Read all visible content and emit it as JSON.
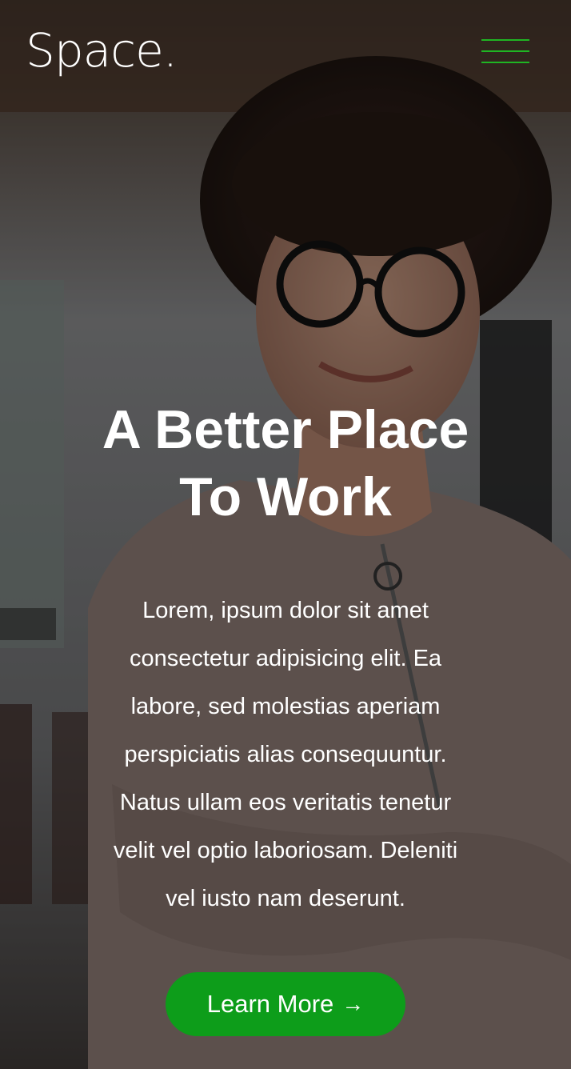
{
  "header": {
    "logo": "Space.",
    "menu_icon": "hamburger-menu-icon"
  },
  "hero": {
    "headline": "A Better Place To Work",
    "body": "Lorem, ipsum dolor sit amet consectetur adipisicing elit. Ea labore, sed molestias aperiam perspiciatis alias consequuntur. Natus ullam eos veritatis tenetur velit vel optio laboriosam. Deleniti vel iusto nam deserunt.",
    "cta_label": "Learn More",
    "cta_arrow": "→"
  },
  "colors": {
    "accent": "#0d9d1a",
    "menu_lines": "#1fb523",
    "text": "#ffffff"
  }
}
